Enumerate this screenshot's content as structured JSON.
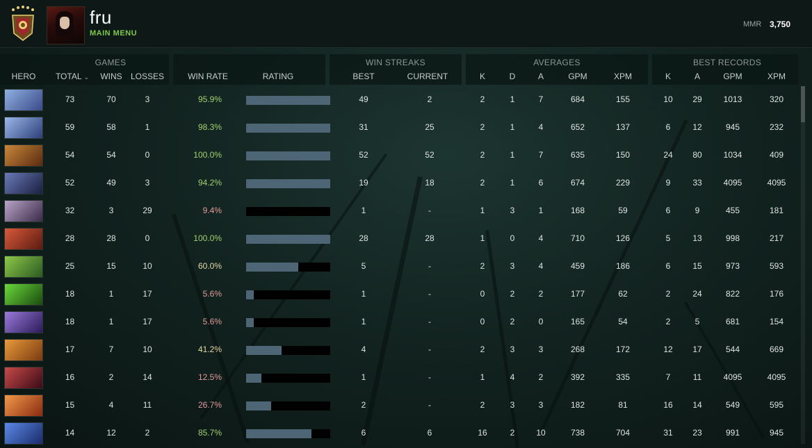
{
  "player": {
    "name": "fru",
    "menu_label": "MAIN MENU"
  },
  "mmr": {
    "label": "MMR",
    "value": "3,750"
  },
  "group_headers": {
    "games": "GAMES",
    "win_streaks": "WIN STREAKS",
    "averages": "AVERAGES",
    "best_records": "BEST RECORDS"
  },
  "columns": {
    "hero": "HERO",
    "total": "TOTAL",
    "wins": "WINS",
    "losses": "LOSSES",
    "win_rate": "WIN RATE",
    "rating": "RATING",
    "best": "BEST",
    "current": "CURRENT",
    "k": "K",
    "d": "D",
    "a": "A",
    "gpm": "GPM",
    "xpm": "XPM",
    "best_k": "K",
    "best_a": "A",
    "best_gpm": "GPM",
    "best_xpm": "XPM"
  },
  "colors": {
    "win_high": "#9fd06e",
    "win_mid": "#e3d9a6",
    "win_low": "#e19a9a",
    "bar": "#4d6575",
    "accent": "#7ec84a"
  },
  "rows": [
    {
      "hero_colors": [
        "#8fb0e0",
        "#3a4a8a"
      ],
      "total": "73",
      "wins": "70",
      "losses": "3",
      "win_rate": "95.9%",
      "rating": 1.0,
      "best": "49",
      "current": "2",
      "k": "2",
      "d": "1",
      "a": "7",
      "gpm": "684",
      "xpm": "155",
      "bk": "10",
      "ba": "29",
      "bgpm": "1013",
      "bxpm": "320"
    },
    {
      "hero_colors": [
        "#9ab8e8",
        "#2c3f7a"
      ],
      "total": "59",
      "wins": "58",
      "losses": "1",
      "win_rate": "98.3%",
      "rating": 1.0,
      "best": "31",
      "current": "25",
      "k": "2",
      "d": "1",
      "a": "4",
      "gpm": "652",
      "xpm": "137",
      "bk": "6",
      "ba": "12",
      "bgpm": "945",
      "bxpm": "232"
    },
    {
      "hero_colors": [
        "#c8873a",
        "#5a2a10"
      ],
      "total": "54",
      "wins": "54",
      "losses": "0",
      "win_rate": "100.0%",
      "rating": 1.0,
      "best": "52",
      "current": "52",
      "k": "2",
      "d": "1",
      "a": "7",
      "gpm": "635",
      "xpm": "150",
      "bk": "24",
      "ba": "80",
      "bgpm": "1034",
      "bxpm": "409"
    },
    {
      "hero_colors": [
        "#6a7ab8",
        "#1a1f40"
      ],
      "total": "52",
      "wins": "49",
      "losses": "3",
      "win_rate": "94.2%",
      "rating": 1.0,
      "best": "19",
      "current": "18",
      "k": "2",
      "d": "1",
      "a": "6",
      "gpm": "674",
      "xpm": "229",
      "bk": "9",
      "ba": "33",
      "bgpm": "4095",
      "bxpm": "4095"
    },
    {
      "hero_colors": [
        "#b9a4c8",
        "#3a2a48"
      ],
      "total": "32",
      "wins": "3",
      "losses": "29",
      "win_rate": "9.4%",
      "rating": 0.0,
      "best": "1",
      "current": "-",
      "k": "1",
      "d": "3",
      "a": "1",
      "gpm": "168",
      "xpm": "59",
      "bk": "6",
      "ba": "9",
      "bgpm": "455",
      "bxpm": "181"
    },
    {
      "hero_colors": [
        "#d85a3a",
        "#5a1a10"
      ],
      "total": "28",
      "wins": "28",
      "losses": "0",
      "win_rate": "100.0%",
      "rating": 1.0,
      "best": "28",
      "current": "28",
      "k": "1",
      "d": "0",
      "a": "4",
      "gpm": "710",
      "xpm": "126",
      "bk": "5",
      "ba": "13",
      "bgpm": "998",
      "bxpm": "217"
    },
    {
      "hero_colors": [
        "#8ec84a",
        "#2a5a20"
      ],
      "total": "25",
      "wins": "15",
      "losses": "10",
      "win_rate": "60.0%",
      "rating": 0.62,
      "best": "5",
      "current": "-",
      "k": "2",
      "d": "3",
      "a": "4",
      "gpm": "459",
      "xpm": "186",
      "bk": "6",
      "ba": "15",
      "bgpm": "973",
      "bxpm": "593"
    },
    {
      "hero_colors": [
        "#6ad83a",
        "#1a4a10"
      ],
      "total": "18",
      "wins": "1",
      "losses": "17",
      "win_rate": "5.6%",
      "rating": 0.09,
      "best": "1",
      "current": "-",
      "k": "0",
      "d": "2",
      "a": "2",
      "gpm": "177",
      "xpm": "62",
      "bk": "2",
      "ba": "24",
      "bgpm": "822",
      "bxpm": "176"
    },
    {
      "hero_colors": [
        "#9a7ad8",
        "#2a1a5a"
      ],
      "total": "18",
      "wins": "1",
      "losses": "17",
      "win_rate": "5.6%",
      "rating": 0.09,
      "best": "1",
      "current": "-",
      "k": "0",
      "d": "2",
      "a": "0",
      "gpm": "165",
      "xpm": "54",
      "bk": "2",
      "ba": "5",
      "bgpm": "681",
      "bxpm": "154"
    },
    {
      "hero_colors": [
        "#e89a3a",
        "#7a3a10"
      ],
      "total": "17",
      "wins": "7",
      "losses": "10",
      "win_rate": "41.2%",
      "rating": 0.42,
      "best": "4",
      "current": "-",
      "k": "2",
      "d": "3",
      "a": "3",
      "gpm": "268",
      "xpm": "172",
      "bk": "12",
      "ba": "17",
      "bgpm": "544",
      "bxpm": "669"
    },
    {
      "hero_colors": [
        "#c84a4a",
        "#3a0a14"
      ],
      "total": "16",
      "wins": "2",
      "losses": "14",
      "win_rate": "12.5%",
      "rating": 0.18,
      "best": "1",
      "current": "-",
      "k": "1",
      "d": "4",
      "a": "2",
      "gpm": "392",
      "xpm": "335",
      "bk": "7",
      "ba": "11",
      "bgpm": "4095",
      "bxpm": "4095"
    },
    {
      "hero_colors": [
        "#f09a4a",
        "#8a2a10"
      ],
      "total": "15",
      "wins": "4",
      "losses": "11",
      "win_rate": "26.7%",
      "rating": 0.3,
      "best": "2",
      "current": "-",
      "k": "2",
      "d": "3",
      "a": "3",
      "gpm": "182",
      "xpm": "81",
      "bk": "16",
      "ba": "14",
      "bgpm": "549",
      "bxpm": "595"
    },
    {
      "hero_colors": [
        "#5a8ae8",
        "#1a2a6a"
      ],
      "total": "14",
      "wins": "12",
      "losses": "2",
      "win_rate": "85.7%",
      "rating": 0.78,
      "best": "6",
      "current": "6",
      "k": "16",
      "d": "2",
      "a": "10",
      "gpm": "738",
      "xpm": "704",
      "bk": "31",
      "ba": "23",
      "bgpm": "991",
      "bxpm": "945"
    }
  ]
}
